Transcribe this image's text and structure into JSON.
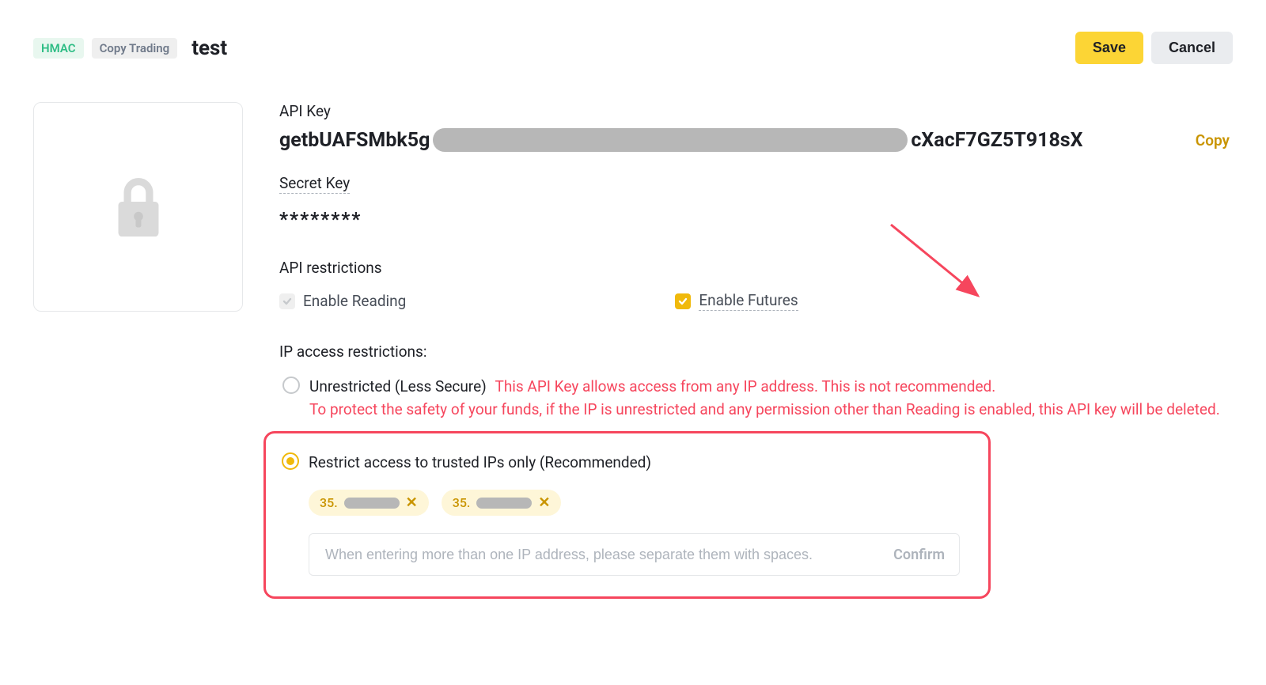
{
  "header": {
    "badge_hmac": "HMAC",
    "badge_copytrading": "Copy Trading",
    "api_name": "test",
    "save_label": "Save",
    "cancel_label": "Cancel"
  },
  "apikey": {
    "label": "API Key",
    "prefix": "getbUAFSMbk5g",
    "suffix": "cXacF7GZ5T918sX",
    "copy_label": "Copy"
  },
  "secret": {
    "label": "Secret Key",
    "value": "********"
  },
  "restrictions": {
    "title": "API restrictions",
    "enable_reading": "Enable Reading",
    "enable_futures": "Enable Futures"
  },
  "ip": {
    "title": "IP access restrictions:",
    "unrestricted_label": "Unrestricted (Less Secure)",
    "unrestricted_warn_inline": "This API Key allows access from any IP address. This is not recommended.",
    "unrestricted_warn_block": "To protect the safety of your funds, if the IP is unrestricted and any permission other than Reading is enabled, this API key will be deleted.",
    "restricted_label": "Restrict access to trusted IPs only (Recommended)",
    "chips": [
      {
        "prefix": "35."
      },
      {
        "prefix": "35."
      }
    ],
    "input_placeholder": "When entering more than one IP address, please separate them with spaces.",
    "confirm_label": "Confirm"
  }
}
